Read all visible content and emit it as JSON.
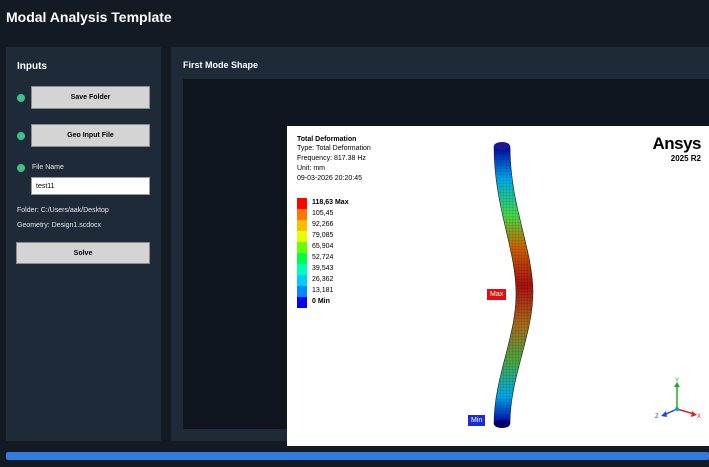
{
  "app": {
    "title": "Modal Analysis Template"
  },
  "inputs": {
    "title": "Inputs",
    "save_folder_label": "Save Folder",
    "geo_input_label": "Geo Input File",
    "file_name_label": "File Name",
    "file_name_value": "test11",
    "folder_text": "Folder: C:/Users/aak/Desktop",
    "geometry_text": "Geometry: Design1.scdocx",
    "solve_label": "Solve",
    "status_color": "#3fc08a"
  },
  "mode_shape": {
    "title": "First Mode Shape",
    "legend": {
      "title": "Total Deformation",
      "type": "Type: Total Deformation",
      "frequency": "Frequency: 817.38 Hz",
      "unit": "Unit: mm",
      "timestamp": "09-03-2026 20:20:45",
      "items": [
        {
          "label": "118,63 Max",
          "color": "#ff0000"
        },
        {
          "label": "105,45",
          "color": "#ff7700"
        },
        {
          "label": "92,266",
          "color": "#ffbb00"
        },
        {
          "label": "79,085",
          "color": "#e6ff00"
        },
        {
          "label": "65,904",
          "color": "#66ff00"
        },
        {
          "label": "52,724",
          "color": "#00ff44"
        },
        {
          "label": "39,543",
          "color": "#00ffbb"
        },
        {
          "label": "26,362",
          "color": "#00ccff"
        },
        {
          "label": "13,181",
          "color": "#0088ff"
        },
        {
          "label": "0 Min",
          "color": "#0000ff"
        }
      ]
    },
    "brand": "Ansys",
    "version": "2025 R2",
    "max_tag": "Max",
    "min_tag": "Min",
    "axes": {
      "x": "X",
      "y": "Y",
      "z": "Z"
    }
  },
  "progress": {
    "value": 1.0,
    "color": "#2f7be0"
  }
}
